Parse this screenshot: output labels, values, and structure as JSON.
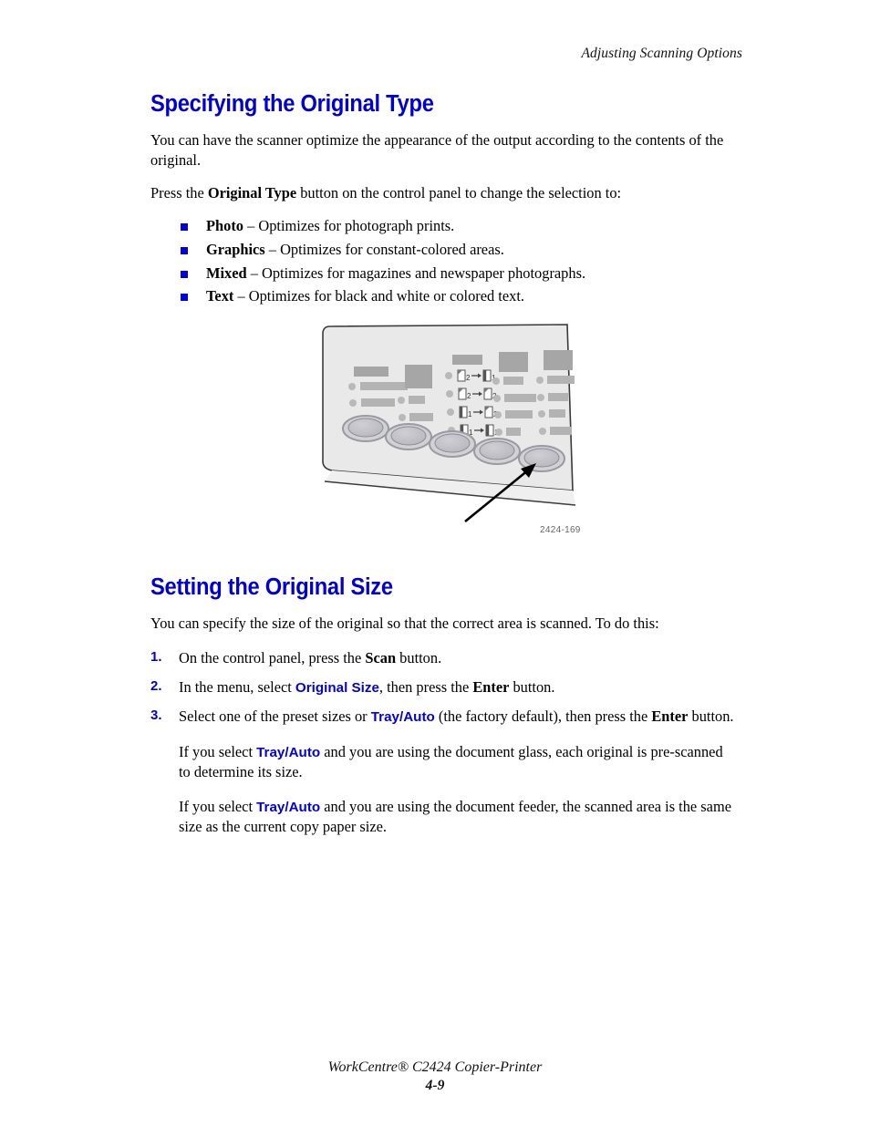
{
  "header": {
    "running_title": "Adjusting Scanning Options"
  },
  "sections": [
    {
      "heading": "Specifying the Original Type",
      "intro": "You can have the scanner optimize the appearance of the output according to the contents of the original.",
      "press_prefix": "Press the ",
      "press_bold": "Original Type",
      "press_suffix": " button on the control panel to change the selection to:",
      "bullets": [
        {
          "term": "Photo",
          "desc": " – Optimizes for photograph prints."
        },
        {
          "term": "Graphics",
          "desc": " – Optimizes for constant-colored areas."
        },
        {
          "term": "Mixed",
          "desc": " – Optimizes for magazines and newspaper photographs."
        },
        {
          "term": "Text",
          "desc": " – Optimizes for black and white or colored text."
        }
      ]
    },
    {
      "heading": "Setting the Original Size",
      "intro": "You can specify the size of the original so that the correct area is scanned. To do this:",
      "steps": [
        {
          "number": "1.",
          "parts": [
            {
              "t": "On the control panel, press the ",
              "style": "plain"
            },
            {
              "t": "Scan",
              "style": "bold"
            },
            {
              "t": " button.",
              "style": "plain"
            }
          ]
        },
        {
          "number": "2.",
          "parts": [
            {
              "t": "In the menu, select ",
              "style": "plain"
            },
            {
              "t": "Original Size",
              "style": "blue"
            },
            {
              "t": ", then press the ",
              "style": "plain"
            },
            {
              "t": "Enter",
              "style": "bold"
            },
            {
              "t": " button.",
              "style": "plain"
            }
          ]
        },
        {
          "number": "3.",
          "parts": [
            {
              "t": "Select one of the preset sizes or ",
              "style": "plain"
            },
            {
              "t": "Tray/Auto",
              "style": "blue"
            },
            {
              "t": " (the factory default), then press the ",
              "style": "plain"
            },
            {
              "t": "Enter",
              "style": "bold"
            },
            {
              "t": " button.",
              "style": "plain"
            }
          ]
        }
      ],
      "notes": [
        {
          "parts": [
            {
              "t": "If you select ",
              "style": "plain"
            },
            {
              "t": "Tray/Auto",
              "style": "blue"
            },
            {
              "t": " and you are using the document glass, each original is pre-scanned to determine its size.",
              "style": "plain"
            }
          ]
        },
        {
          "parts": [
            {
              "t": "If you select ",
              "style": "plain"
            },
            {
              "t": "Tray/Auto",
              "style": "blue"
            },
            {
              "t": " and you are using the document feeder, the scanned area is the same size as the current copy paper size.",
              "style": "plain"
            }
          ]
        }
      ]
    }
  ],
  "figure": {
    "caption": "2424-169",
    "alt": "Control panel illustration with arrow pointing to the Original Type button",
    "duplex_labels": [
      "2",
      "1",
      "2",
      "2",
      "1",
      "2",
      "1",
      "1"
    ],
    "duplex_rows": [
      {
        "from": "2",
        "to": "1"
      },
      {
        "from": "2",
        "to": "2"
      },
      {
        "from": "1",
        "to": "2"
      },
      {
        "from": "1",
        "to": "1"
      }
    ]
  },
  "footer": {
    "product": "WorkCentre® C2424 Copier-Printer",
    "page_number": "4-9"
  },
  "colors": {
    "heading_blue": "#0000d4",
    "term_blue": "#0000e0",
    "panel_face": "#e8e8e8",
    "panel_label": "#a8a8a8",
    "panel_outline": "#333333"
  }
}
